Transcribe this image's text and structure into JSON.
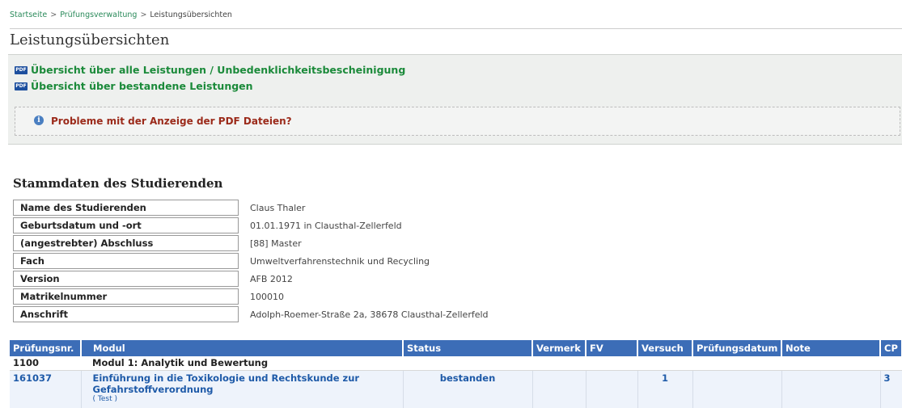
{
  "breadcrumb": {
    "items": [
      "Startseite",
      "Prüfungsverwaltung"
    ],
    "separator": ">",
    "current": "Leistungsübersichten"
  },
  "page_title": "Leistungsübersichten",
  "pdf_panel": {
    "links": [
      {
        "label": "Übersicht über alle Leistungen / Unbedenklichkeitsbescheinigung",
        "icon": "pdf-icon"
      },
      {
        "label": "Übersicht über bestandene Leistungen",
        "icon": "pdf-icon"
      }
    ],
    "icon_text": "PDF",
    "help": {
      "label": "Probleme mit der Anzeige der PDF Dateien?",
      "icon": "info-icon",
      "icon_text": "i"
    }
  },
  "stammdaten": {
    "title": "Stammdaten des Studierenden",
    "rows": [
      {
        "label": "Name des Studierenden",
        "value": "Claus Thaler"
      },
      {
        "label": "Geburtsdatum und -ort",
        "value": "01.01.1971 in Clausthal-Zellerfeld"
      },
      {
        "label": "(angestrebter) Abschluss",
        "value": "[88] Master"
      },
      {
        "label": "Fach",
        "value": "Umweltverfahrenstechnik und Recycling"
      },
      {
        "label": "Version",
        "value": "AFB 2012"
      },
      {
        "label": "Matrikelnummer",
        "value": "100010"
      },
      {
        "label": "Anschrift",
        "value": "Adolph-Roemer-Straße 2a, 38678 Clausthal-Zellerfeld"
      }
    ]
  },
  "results": {
    "headers": [
      "Prüfungsnr.",
      "Modul",
      "Status",
      "Vermerk",
      "FV",
      "Versuch",
      "Prüfungsdatum",
      "Note",
      "CP"
    ],
    "group": {
      "nr": "1100",
      "name": "Modul 1: Analytik und Bewertung"
    },
    "rows": [
      {
        "nr": "161037",
        "modul": "Einführung in die Toxikologie und Rechtskunde zur Gefahrstoffverordnung",
        "tag": "( Test )",
        "status": "bestanden",
        "vermerk": "",
        "fv": "",
        "versuch": "1",
        "datum": "",
        "note": "",
        "cp": "3"
      }
    ]
  },
  "colors": {
    "link_green": "#1b8a3a",
    "header_blue": "#3c6db7",
    "link_blue": "#1e5aa8",
    "warning_red": "#9b2a1a"
  }
}
